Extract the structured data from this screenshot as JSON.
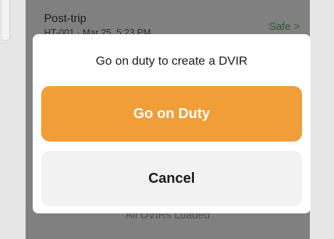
{
  "background": {
    "row_title": "Post-trip",
    "row_subtitle": "HT-001 · Mar 25, 5:23 PM",
    "row_status": "Safe >",
    "footer_text": "All DVIRs Loaded"
  },
  "modal": {
    "message": "Go on duty to create a DVIR",
    "primary_label": "Go on Duty",
    "secondary_label": "Cancel"
  },
  "colors": {
    "primary": "#f19d38",
    "secondary": "#f2f2f2",
    "overlay": "#808080"
  }
}
